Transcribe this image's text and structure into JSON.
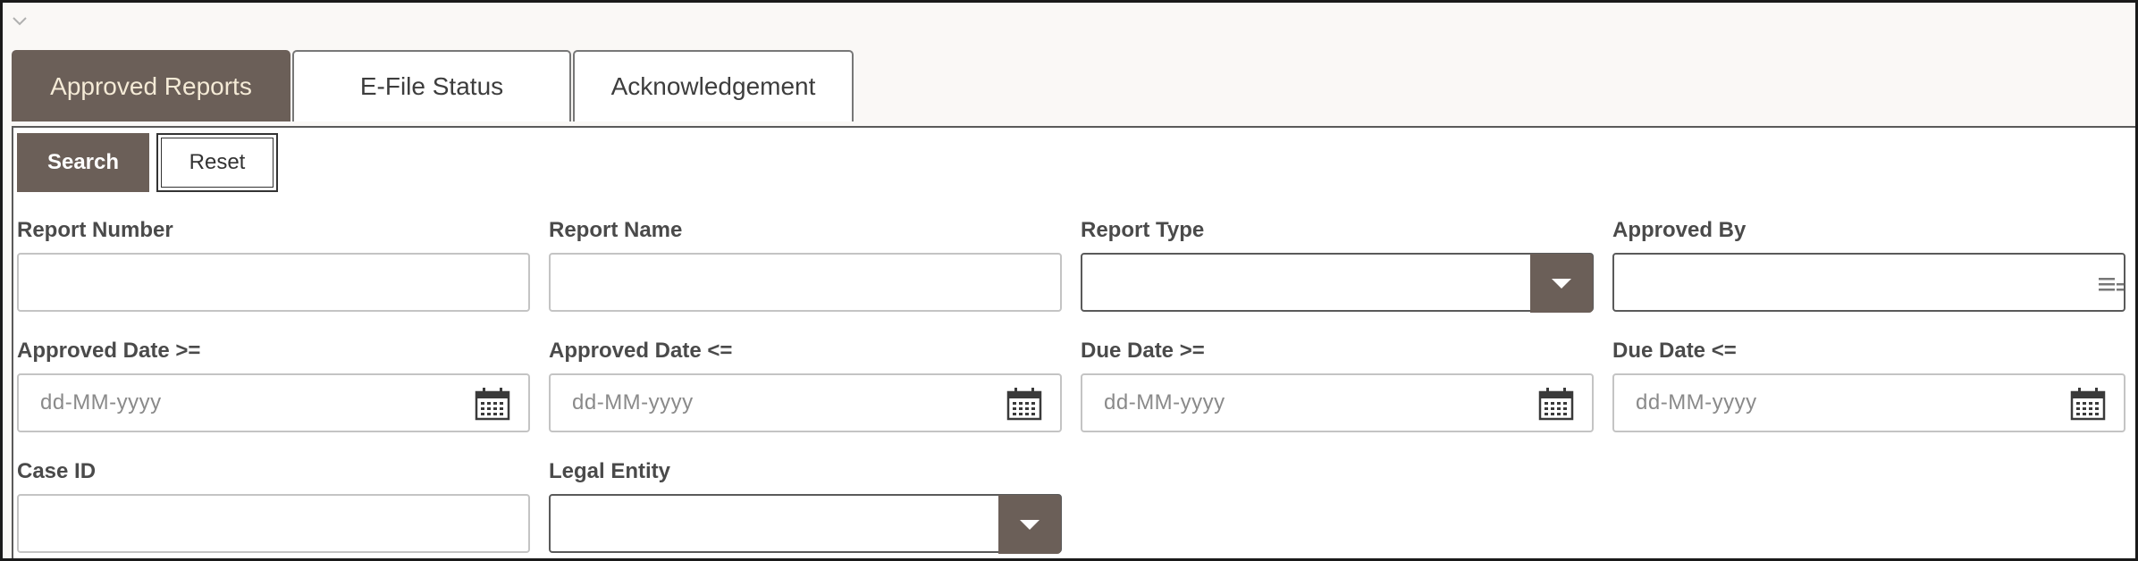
{
  "tabs": [
    {
      "label": "Approved Reports",
      "active": true
    },
    {
      "label": "E-File Status",
      "active": false
    },
    {
      "label": "Acknowledgement",
      "active": false
    }
  ],
  "buttons": {
    "search": "Search",
    "reset": "Reset"
  },
  "fields": {
    "report_number": {
      "label": "Report Number",
      "value": ""
    },
    "report_name": {
      "label": "Report Name",
      "value": ""
    },
    "report_type": {
      "label": "Report Type",
      "value": ""
    },
    "approved_by": {
      "label": "Approved By",
      "value": ""
    },
    "approved_date_from": {
      "label": "Approved Date >=",
      "placeholder": "dd-MM-yyyy"
    },
    "approved_date_to": {
      "label": "Approved Date <=",
      "placeholder": "dd-MM-yyyy"
    },
    "due_date_from": {
      "label": "Due Date >=",
      "placeholder": "dd-MM-yyyy"
    },
    "due_date_to": {
      "label": "Due Date <=",
      "placeholder": "dd-MM-yyyy"
    },
    "case_id": {
      "label": "Case ID",
      "value": ""
    },
    "legal_entity": {
      "label": "Legal Entity",
      "value": ""
    }
  },
  "icons": {
    "collapse": "chevron-down-icon",
    "dropdown": "caret-down-icon",
    "date": "calendar-icon",
    "lookup": "list-icon"
  },
  "colors": {
    "accent": "#6b5f58",
    "active_tab_text": "#f4ead6",
    "frame_bg": "#faf8f6"
  }
}
